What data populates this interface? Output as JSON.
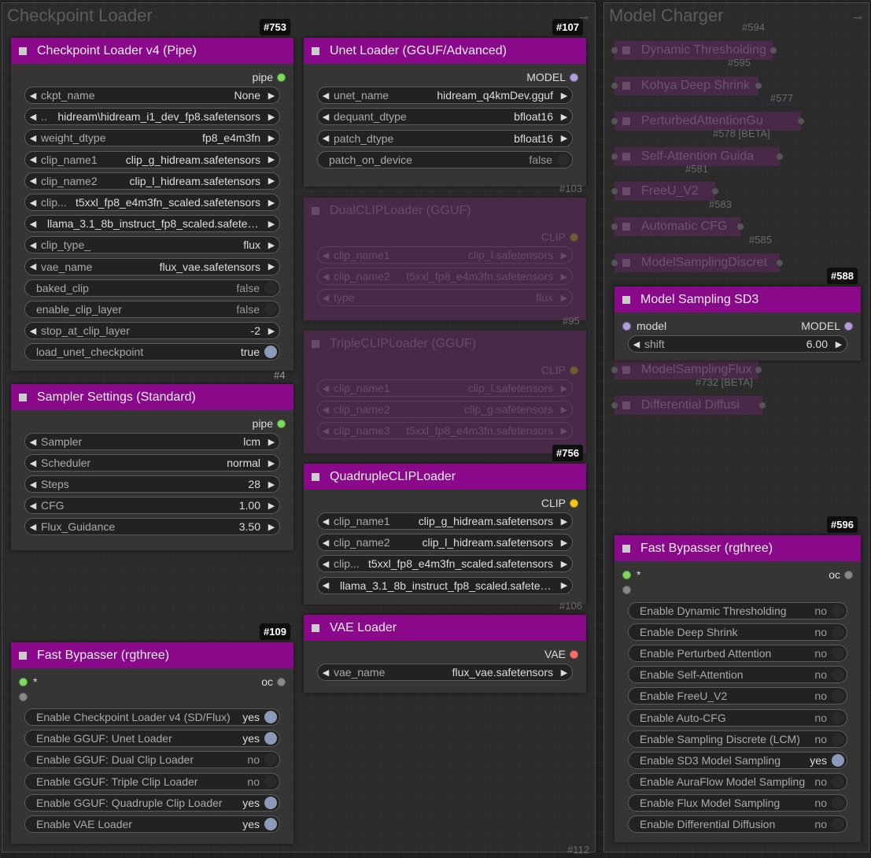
{
  "groups": {
    "checkpoint": {
      "title": "Checkpoint Loader"
    },
    "model": {
      "title": "Model Charger"
    }
  },
  "ckpt": {
    "id": "#753",
    "title": "Checkpoint Loader v4 (Pipe)",
    "output": "pipe",
    "widgets": [
      {
        "label": "ckpt_name",
        "value": "None"
      },
      {
        "label": "..",
        "value": "hidream\\hidream_i1_dev_fp8.safetensors"
      },
      {
        "label": "weight_dtype",
        "value": "fp8_e4m3fn"
      },
      {
        "label": "clip_name1",
        "value": "clip_g_hidream.safetensors"
      },
      {
        "label": "clip_name2",
        "value": "clip_l_hidream.safetensors"
      },
      {
        "label": "clip...",
        "value": "t5xxl_fp8_e4m3fn_scaled.safetensors"
      },
      {
        "label": "",
        "value": "llama_3.1_8b_instruct_fp8_scaled.safeten..."
      },
      {
        "label": "clip_type_",
        "value": "flux"
      },
      {
        "label": "vae_name",
        "value": "flux_vae.safetensors"
      },
      {
        "label": "baked_clip",
        "value": "false"
      },
      {
        "label": "enable_clip_layer",
        "value": "false"
      },
      {
        "label": "stop_at_clip_layer",
        "value": "-2"
      },
      {
        "label": "load_unet_checkpoint",
        "value": "true"
      }
    ],
    "footer_id": "#4"
  },
  "sampler": {
    "title": "Sampler Settings (Standard)",
    "output": "pipe",
    "widgets": [
      {
        "label": "Sampler",
        "value": "lcm"
      },
      {
        "label": "Scheduler",
        "value": "normal"
      },
      {
        "label": "Steps",
        "value": "28"
      },
      {
        "label": "CFG",
        "value": "1.00"
      },
      {
        "label": "Flux_Guidance",
        "value": "3.50"
      }
    ]
  },
  "bypass1": {
    "id": "#109",
    "title": "Fast Bypasser (rgthree)",
    "input": "*",
    "output": "oc",
    "toggles": [
      {
        "label": "Enable Checkpoint Loader v4 (SD/Flux)",
        "value": "yes"
      },
      {
        "label": "Enable GGUF: Unet Loader",
        "value": "yes"
      },
      {
        "label": "Enable GGUF: Dual Clip Loader",
        "value": "no"
      },
      {
        "label": "Enable GGUF: Triple Clip Loader",
        "value": "no"
      },
      {
        "label": "Enable GGUF: Quadruple Clip Loader",
        "value": "yes"
      },
      {
        "label": "Enable VAE Loader",
        "value": "yes"
      }
    ],
    "footer_id": "#112"
  },
  "unet": {
    "id": "#107",
    "title": "Unet Loader (GGUF/Advanced)",
    "output": "MODEL",
    "widgets": [
      {
        "label": "unet_name",
        "value": "hidream_q4kmDev.gguf"
      },
      {
        "label": "dequant_dtype",
        "value": "bfloat16"
      },
      {
        "label": "patch_dtype",
        "value": "bfloat16"
      },
      {
        "label": "patch_on_device",
        "value": "false"
      }
    ],
    "footer_id": "#103"
  },
  "dual": {
    "title": "DualCLIPLoader (GGUF)",
    "output": "CLIP",
    "widgets": [
      {
        "label": "clip_name1",
        "value": "clip_l.safetensors"
      },
      {
        "label": "clip_name2",
        "value": "t5xxl_fp8_e4m3fn.safetensors"
      },
      {
        "label": "type",
        "value": "flux"
      }
    ],
    "footer_id": "#95"
  },
  "triple": {
    "title": "TripleCLIPLoader (GGUF)",
    "output": "CLIP",
    "widgets": [
      {
        "label": "clip_name1",
        "value": "clip_l.safetensors"
      },
      {
        "label": "clip_name2",
        "value": "clip_g.safetensors"
      },
      {
        "label": "clip_name3",
        "value": "t5xxl_fp8_e4m3fn.safetensors"
      }
    ]
  },
  "quad": {
    "id": "#756",
    "title": "QuadrupleCLIPLoader",
    "output": "CLIP",
    "widgets": [
      {
        "label": "clip_name1",
        "value": "clip_g_hidream.safetensors"
      },
      {
        "label": "clip_name2",
        "value": "clip_l_hidream.safetensors"
      },
      {
        "label": "clip...",
        "value": "t5xxl_fp8_e4m3fn_scaled.safetensors"
      },
      {
        "label": "",
        "value": "llama_3.1_8b_instruct_fp8_scaled.safeten..."
      }
    ],
    "footer_id": "#106"
  },
  "vae": {
    "title": "VAE Loader",
    "output": "VAE",
    "widgets": [
      {
        "label": "vae_name",
        "value": "flux_vae.safetensors"
      }
    ]
  },
  "collapsed": [
    {
      "id": "#594",
      "title": "Dynamic Thresholding"
    },
    {
      "id": "#595",
      "title": "Kohya Deep Shrink"
    },
    {
      "id": "#577",
      "title": "PerturbedAttentionGu"
    },
    {
      "id": "#578 [BETA]",
      "title": "Self-Attention Guida"
    },
    {
      "id": "#581",
      "title": "FreeU_V2"
    },
    {
      "id": "#583",
      "title": "Automatic CFG"
    },
    {
      "id": "#585",
      "title": "ModelSamplingDiscret"
    }
  ],
  "collapsed2": [
    {
      "id": "",
      "title": "ModelSamplingFlux"
    },
    {
      "id": "#732 [BETA]",
      "title": "Differential Diffusi"
    }
  ],
  "sd3": {
    "id": "#588",
    "title": "Model Sampling SD3",
    "input": "model",
    "output": "MODEL",
    "widgets": [
      {
        "label": "shift",
        "value": "6.00"
      }
    ]
  },
  "bypass2": {
    "id": "#596",
    "title": "Fast Bypasser (rgthree)",
    "input": "*",
    "output": "oc",
    "toggles": [
      {
        "label": "Enable Dynamic Thresholding",
        "value": "no"
      },
      {
        "label": "Enable Deep Shrink",
        "value": "no"
      },
      {
        "label": "Enable Perturbed Attention",
        "value": "no"
      },
      {
        "label": "Enable Self-Attention",
        "value": "no"
      },
      {
        "label": "Enable FreeU_V2",
        "value": "no"
      },
      {
        "label": "Enable Auto-CFG",
        "value": "no"
      },
      {
        "label": "Enable Sampling Discrete (LCM)",
        "value": "no"
      },
      {
        "label": "Enable SD3 Model Sampling",
        "value": "yes"
      },
      {
        "label": "Enable AuraFlow Model Sampling",
        "value": "no"
      },
      {
        "label": "Enable Flux Model Sampling",
        "value": "no"
      },
      {
        "label": "Enable Differential Diffusion",
        "value": "no"
      }
    ]
  },
  "colors": {
    "pipe": "#7cd95e",
    "model": "#b39ddb",
    "clip": "#f5c518",
    "vae": "#ff6e6e",
    "node_header": "#8a088a"
  }
}
